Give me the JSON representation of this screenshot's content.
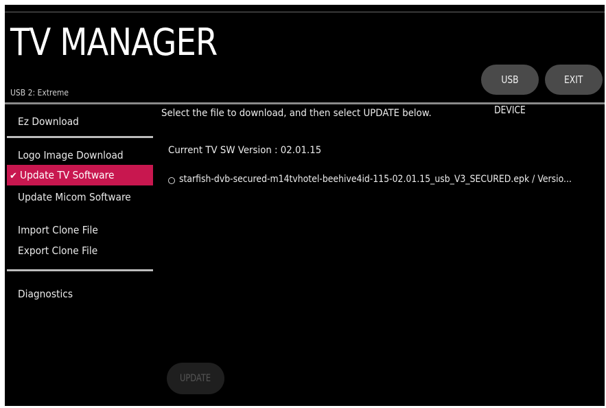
{
  "header": {
    "title": "TV MANAGER",
    "usb_label": "USB 2: Extreme",
    "usb_device_button": "USB DEVICE",
    "exit_button": "EXIT"
  },
  "sidebar": {
    "items": [
      {
        "label": "Ez Download",
        "selected": false
      },
      {
        "label": "Logo Image Download",
        "selected": false
      },
      {
        "label": "Update TV Software",
        "selected": true
      },
      {
        "label": "Update Micom Software",
        "selected": false
      },
      {
        "label": "Import Clone File",
        "selected": false
      },
      {
        "label": "Export Clone File",
        "selected": false
      },
      {
        "label": "Diagnostics",
        "selected": false
      }
    ],
    "check_icon": "✔"
  },
  "main": {
    "instruction": "Select the file to download, and then select UPDATE below.",
    "current_version_text": "Current TV SW Version :  02.01.15",
    "file_name": "starfish-dvb-secured-m14tvhotel-beehive4id-115-02.01.15_usb_V3_SECURED.epk / Versio...",
    "update_button": "UPDATE",
    "update_enabled": false
  },
  "colors": {
    "background": "#000000",
    "selected_item": "#c8174f",
    "button": "#4a4a4a",
    "disabled_button": "#1f1f1f"
  }
}
